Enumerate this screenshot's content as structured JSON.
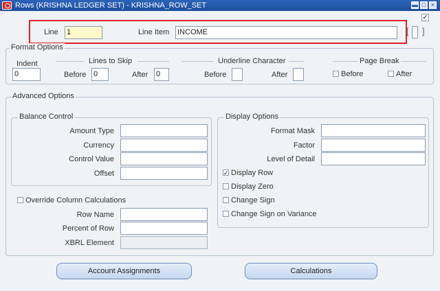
{
  "window": {
    "title": "Rows (KRISHNA LEDGER SET) - KRISHNA_ROW_SET",
    "minimize_symbol": "▬",
    "maximize_symbol": "□",
    "close_symbol": "×",
    "corner_check": "✓"
  },
  "header": {
    "line_label": "Line",
    "line_value": "1",
    "line_item_label": "Line Item",
    "line_item_value": "INCOME",
    "bracket_left": "[",
    "bracket_right": "]"
  },
  "format_options": {
    "title": "Format Options",
    "indent_label": "Indent",
    "indent_value": "0",
    "lines_to_skip_label": "Lines to Skip",
    "before_label": "Before",
    "before_value": "0",
    "after_label": "After",
    "after_value": "0",
    "underline_label": "Underline Character",
    "underline_before_label": "Before",
    "underline_before_value": "",
    "underline_after_label": "After",
    "underline_after_value": "",
    "page_break_label": "Page Break",
    "pb_before_label": "Before",
    "pb_after_label": "After"
  },
  "advanced": {
    "title": "Advanced Options",
    "balance_control": {
      "title": "Balance Control",
      "amount_type_label": "Amount Type",
      "currency_label": "Currency",
      "control_value_label": "Control Value",
      "offset_label": "Offset"
    },
    "display_options": {
      "title": "Display Options",
      "format_mask_label": "Format Mask",
      "factor_label": "Factor",
      "level_of_detail_label": "Level of Detail",
      "display_row_label": "Display Row",
      "display_row_checked": "✓",
      "display_zero_label": "Display Zero",
      "change_sign_label": "Change Sign",
      "change_sign_variance_label": "Change Sign on Variance"
    },
    "override_label": "Override Column Calculations",
    "row_name_label": "Row Name",
    "percent_of_row_label": "Percent of Row",
    "xbrl_label": "XBRL Element"
  },
  "buttons": {
    "account_assignments": "Account Assignments",
    "calculations": "Calculations"
  }
}
